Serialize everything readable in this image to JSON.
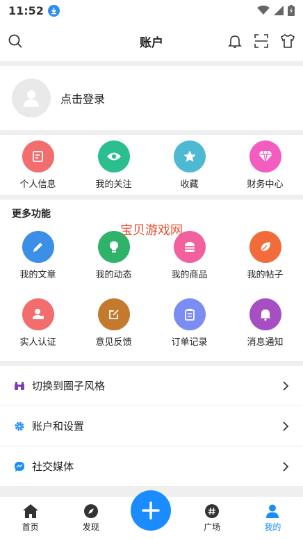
{
  "status": {
    "time": "11:52"
  },
  "header": {
    "title": "账户"
  },
  "login": {
    "text": "点击登录"
  },
  "quick": [
    {
      "label": "个人信息",
      "color": "#f26d6d",
      "icon": "edit-note-icon"
    },
    {
      "label": "我的关注",
      "color": "#2bbf8f",
      "icon": "eye-icon"
    },
    {
      "label": "收藏",
      "color": "#4fb9d3",
      "icon": "star-icon"
    },
    {
      "label": "财务中心",
      "color": "#f25dbf",
      "icon": "diamond-icon"
    }
  ],
  "more": {
    "title": "更多功能",
    "watermark": "宝贝游戏网",
    "rows": [
      [
        {
          "label": "我的文章",
          "color": "#3b8fe6",
          "icon": "pencil-icon"
        },
        {
          "label": "我的动态",
          "color": "#2fb36a",
          "icon": "bulb-icon"
        },
        {
          "label": "我的商品",
          "color": "#f2609e",
          "icon": "burger-icon"
        },
        {
          "label": "我的帖子",
          "color": "#f26b3a",
          "icon": "leaf-icon"
        }
      ],
      [
        {
          "label": "实人认证",
          "color": "#f26d6d",
          "icon": "id-person-icon"
        },
        {
          "label": "意见反馈",
          "color": "#c47a2c",
          "icon": "feedback-edit-icon"
        },
        {
          "label": "订单记录",
          "color": "#7b8cf2",
          "icon": "clipboard-icon"
        },
        {
          "label": "消息通知",
          "color": "#a54fc2",
          "icon": "bell-icon"
        }
      ]
    ]
  },
  "list": [
    {
      "label": "切换到圈子风格",
      "icon": "binoculars-icon",
      "color": "#7a3fb5"
    },
    {
      "label": "账户和设置",
      "icon": "gear-icon",
      "color": "#1a8cff"
    },
    {
      "label": "社交媒体",
      "icon": "messenger-icon",
      "color": "#1a8cff"
    }
  ],
  "tabs": {
    "home": "首页",
    "discover": "发现",
    "square": "广场",
    "mine": "我的"
  },
  "colors": {
    "accent": "#1a8cff"
  }
}
